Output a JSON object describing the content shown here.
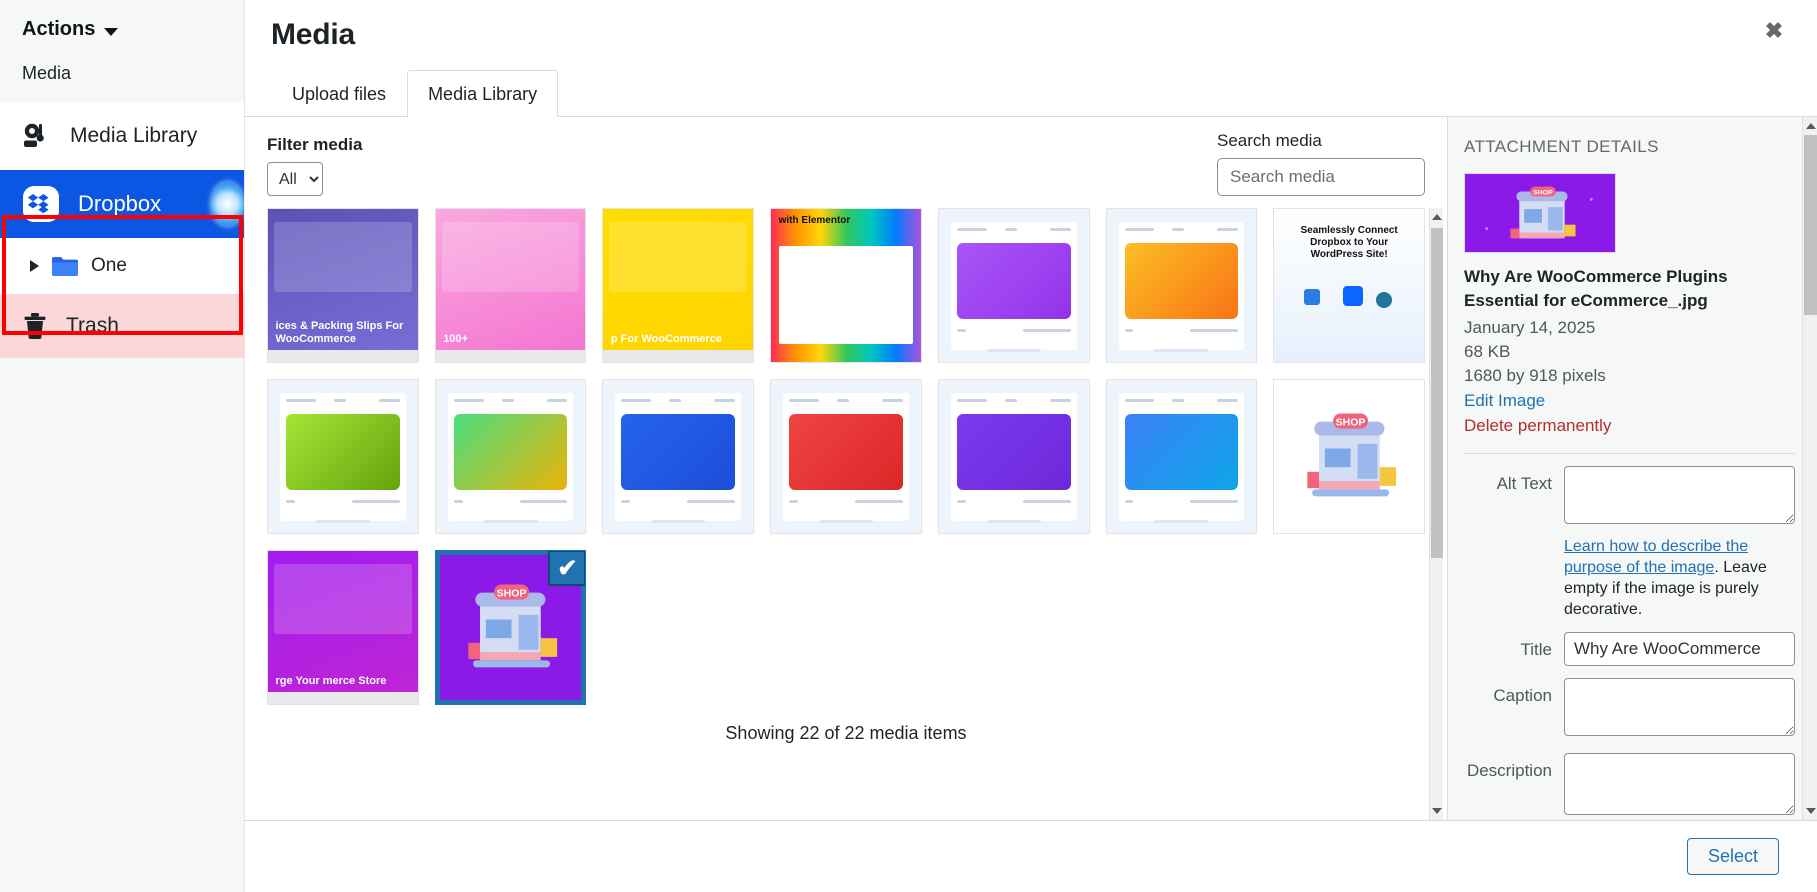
{
  "sidebar": {
    "actions_label": "Actions",
    "media_label": "Media",
    "items": [
      {
        "label": "Media Library",
        "icon": "media-library-icon"
      },
      {
        "label": "Dropbox",
        "icon": "dropbox-icon"
      },
      {
        "label": "One",
        "icon": "folder-icon"
      },
      {
        "label": "Trash",
        "icon": "trash-icon"
      }
    ]
  },
  "modal": {
    "title": "Media",
    "close_icon": "close-icon",
    "tabs": [
      {
        "label": "Upload files",
        "active": false
      },
      {
        "label": "Media Library",
        "active": true
      }
    ]
  },
  "filters": {
    "filter_label": "Filter media",
    "filter_selected": "All d",
    "filter_options": [
      "All d"
    ],
    "search_label": "Search media",
    "search_placeholder": "Search media",
    "search_value": ""
  },
  "grid": {
    "showing_text": "Showing 22 of 22 media items",
    "selected_index": 17,
    "items": [
      {
        "name": "invoices-packing-slips",
        "kind": "banner",
        "c1": "#5b52b8",
        "c2": "#7a6fd6",
        "label": "ices & Packing Slips For WooCommerce"
      },
      {
        "name": "wordpress-plugins-pink",
        "kind": "banner",
        "c1": "#f9a8e0",
        "c2": "#f472d0",
        "label": "100+"
      },
      {
        "name": "tandem-bike-yellow",
        "kind": "banner",
        "c1": "#ffdd00",
        "c2": "#ffd400",
        "label": "p For WooCommerce"
      },
      {
        "name": "connect-dropbox-elementor",
        "kind": "rainbow",
        "c1": "#ffffff",
        "c2": "#ffffff",
        "label": "with Elementor"
      },
      {
        "name": "swatch-purple-1",
        "kind": "swatch",
        "c1": "#a855f7",
        "c2": "#9333ea",
        "label": ""
      },
      {
        "name": "swatch-orange-1",
        "kind": "swatch",
        "c1": "#fbbf24",
        "c2": "#f97316",
        "label": ""
      },
      {
        "name": "connect-dropbox-wordpress",
        "kind": "infographic",
        "c1": "#ffffff",
        "c2": "#e8f2fd",
        "label": "Seamlessly Connect Dropbox to Your WordPress Site!"
      },
      {
        "name": "swatch-green-1",
        "kind": "swatch",
        "c1": "#a3e635",
        "c2": "#65a30d",
        "label": ""
      },
      {
        "name": "swatch-green-yellow",
        "kind": "swatch",
        "c1": "#4ade80",
        "c2": "#eab308",
        "label": ""
      },
      {
        "name": "swatch-blue-1",
        "kind": "swatch",
        "c1": "#2563eb",
        "c2": "#1d4ed8",
        "label": ""
      },
      {
        "name": "swatch-red-1",
        "kind": "swatch",
        "c1": "#ef4444",
        "c2": "#dc2626",
        "label": ""
      },
      {
        "name": "swatch-purple-2",
        "kind": "swatch",
        "c1": "#7c3aed",
        "c2": "#6d28d9",
        "label": ""
      },
      {
        "name": "swatch-blue-2",
        "kind": "swatch",
        "c1": "#3b82f6",
        "c2": "#0ea5e9",
        "label": ""
      },
      {
        "name": "shop-illustration-white",
        "kind": "shop",
        "c1": "#ffffff",
        "c2": "#ffffff",
        "label": "SHOP"
      },
      {
        "name": "supercharge-ecommerce-store",
        "kind": "banner",
        "c1": "#a21cf0",
        "c2": "#c026d3",
        "label": "rge Your merce Store"
      },
      {
        "name": "why-woocommerce-plugins-essential",
        "kind": "shop-purple",
        "c1": "#8b1ae8",
        "c2": "#7c1fd4",
        "label": "SHOP"
      }
    ]
  },
  "attachment": {
    "panel_title": "ATTACHMENT DETAILS",
    "thumbnail_label": "SHOP",
    "filename": "Why Are WooCommerce Plugins Essential for eCommerce_.jpg",
    "date": "January 14, 2025",
    "filesize": "68 KB",
    "dimensions": "1680 by 918 pixels",
    "edit_image": "Edit Image",
    "delete_permanently": "Delete permanently",
    "fields": {
      "alt_text_label": "Alt Text",
      "alt_text_value": "",
      "alt_help_link": "Learn how to describe the purpose of the image",
      "alt_help_rest": ". Leave empty if the image is purely decorative.",
      "title_label": "Title",
      "title_value": "Why Are WooCommerce",
      "caption_label": "Caption",
      "caption_value": "",
      "description_label": "Description",
      "description_value": ""
    }
  },
  "footer": {
    "select_label": "Select"
  },
  "colors": {
    "accent_blue": "#2271b1",
    "sidebar_active": "#0b57e3",
    "danger_red": "#b32d2e",
    "highlight_red": "#ff0000",
    "trash_bg": "#fbd7d7"
  }
}
